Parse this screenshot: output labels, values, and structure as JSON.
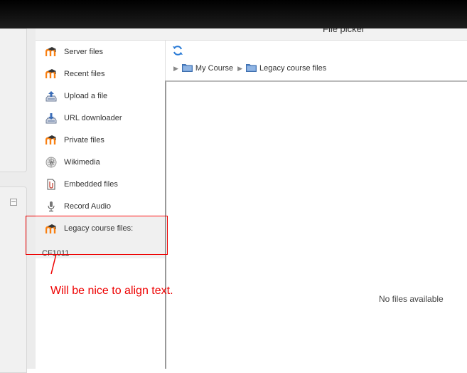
{
  "dialog": {
    "title": "File picker"
  },
  "sidebar": {
    "items": [
      {
        "label": "Server files",
        "icon": "moodle-icon"
      },
      {
        "label": "Recent files",
        "icon": "moodle-icon"
      },
      {
        "label": "Upload a file",
        "icon": "upload-icon"
      },
      {
        "label": "URL downloader",
        "icon": "download-icon"
      },
      {
        "label": "Private files",
        "icon": "moodle-icon"
      },
      {
        "label": "Wikimedia",
        "icon": "wikimedia-icon"
      },
      {
        "label": "Embedded files",
        "icon": "file-icon"
      },
      {
        "label": "Record Audio",
        "icon": "microphone-icon"
      },
      {
        "label": "Legacy course files:",
        "sub": "CF1011",
        "icon": "moodle-icon",
        "active": true
      }
    ]
  },
  "breadcrumb": [
    {
      "label": "My Course"
    },
    {
      "label": "Legacy course files"
    }
  ],
  "content": {
    "empty_message": "No files available"
  },
  "annotation": {
    "text": "Will be nice to align text.",
    "color": "#ee0000"
  },
  "colors": {
    "moodle_orange": "#f98012",
    "folder_blue": "#5b8ecf",
    "header_bg": "#f2f2f2"
  }
}
